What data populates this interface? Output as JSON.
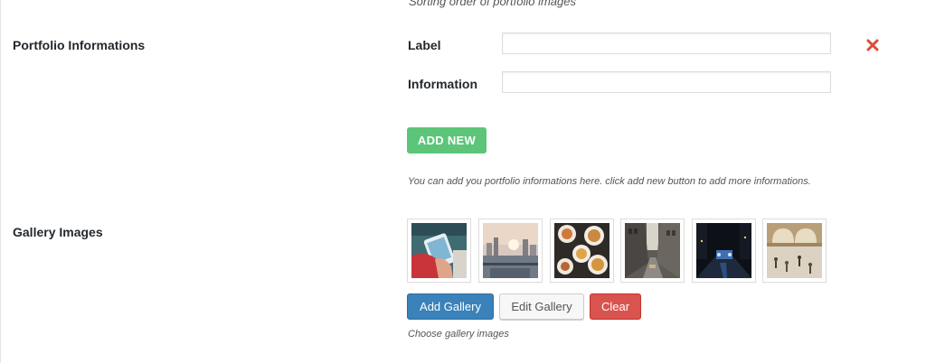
{
  "top_cut_text": "Sorting order of portfolio images",
  "portfolio": {
    "section_label": "Portfolio Informations",
    "label_field_label": "Label",
    "label_value": "",
    "information_field_label": "Information",
    "information_value": "",
    "add_new_label": "ADD NEW",
    "help_text": "You can add you portfolio informations here. click add new button to add more informations."
  },
  "gallery": {
    "section_label": "Gallery Images",
    "images": [
      {
        "icon": "phone-in-hand-photo"
      },
      {
        "icon": "city-skyline-photo"
      },
      {
        "icon": "food-table-photo"
      },
      {
        "icon": "city-street-photo"
      },
      {
        "icon": "night-city-photo"
      },
      {
        "icon": "train-station-hall-photo"
      }
    ],
    "add_gallery_label": "Add Gallery",
    "edit_gallery_label": "Edit Gallery",
    "clear_label": "Clear",
    "help_text": "Choose gallery images"
  },
  "colors": {
    "add_new": "#5cc579",
    "remove_icon": "#dc4b3b",
    "primary_button": "#3a82b9",
    "danger_button": "#d9534f"
  }
}
